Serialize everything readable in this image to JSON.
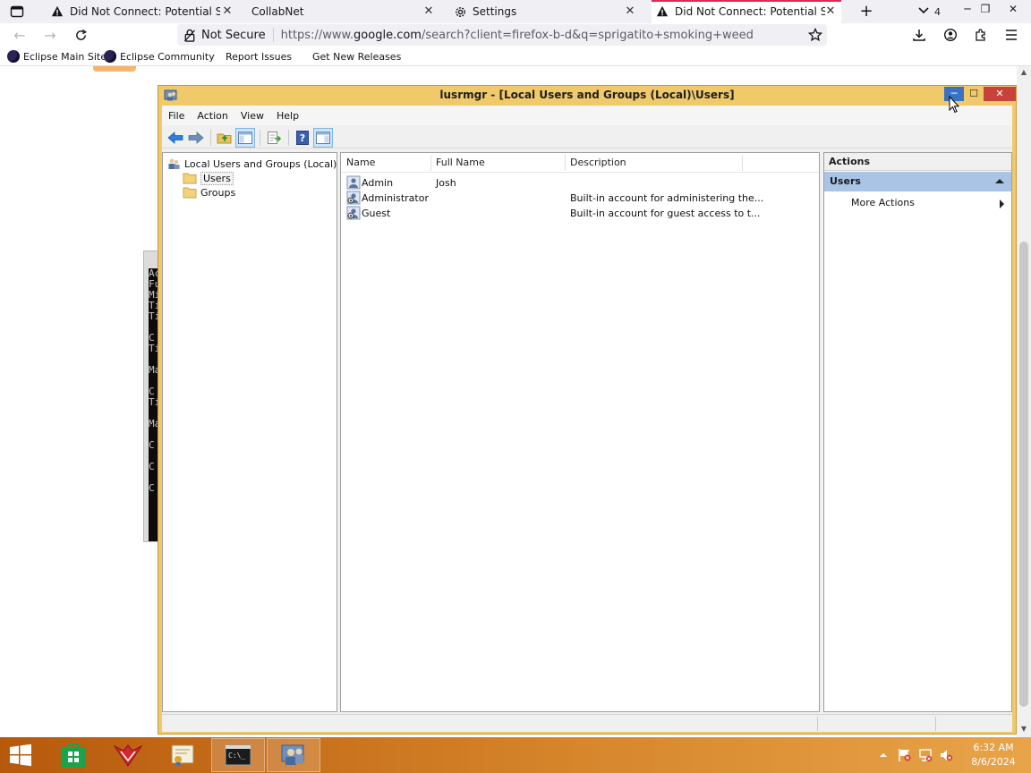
{
  "browser": {
    "tabs": [
      {
        "label": "Did Not Connect: Potential Security Issue",
        "icon": "warning-icon"
      },
      {
        "label": "CollabNet",
        "icon": ""
      },
      {
        "label": "Settings",
        "icon": "gear-icon"
      },
      {
        "label": "Did Not Connect: Potential Security Issue",
        "icon": "warning-icon"
      }
    ],
    "tab_count": "4",
    "security_label": "Not Secure",
    "url_prefix": "https://www.",
    "url_domain": "google.com",
    "url_rest": "/search?client=firefox-b-d&q=sprigatito+smoking+weed",
    "bookmarks": [
      {
        "label": "Eclipse Main Site"
      },
      {
        "label": "Eclipse Community"
      },
      {
        "label": "Report Issues"
      },
      {
        "label": "Get New Releases"
      }
    ]
  },
  "console_fragment": [
    "Ac",
    "Fu",
    "Mi",
    "Ti",
    "Ti",
    "",
    "C",
    "Ti",
    "",
    "Ma",
    "",
    "C",
    "Ti",
    "",
    "Ma",
    "",
    "C",
    "",
    "C",
    "",
    "C"
  ],
  "mmc": {
    "title": "lusrmgr - [Local Users and Groups (Local)\\Users]",
    "menu": [
      "File",
      "Action",
      "View",
      "Help"
    ],
    "tree": {
      "root": "Local Users and Groups (Local)",
      "children": [
        "Users",
        "Groups"
      ]
    },
    "columns": {
      "name": "Name",
      "full_name": "Full Name",
      "description": "Description"
    },
    "users": [
      {
        "name": "Admin",
        "full_name": "Josh",
        "description": ""
      },
      {
        "name": "Administrator",
        "full_name": "",
        "description": "Built-in account for administering the..."
      },
      {
        "name": "Guest",
        "full_name": "",
        "description": "Built-in account for guest access to t..."
      }
    ],
    "actions": {
      "header": "Actions",
      "section": "Users",
      "items": [
        "More Actions"
      ]
    }
  },
  "taskbar": {
    "time": "6:32 AM",
    "date": "8/6/2024"
  },
  "colors": {
    "window_frame": "#f0c96a",
    "taskbar_start": "#b7590c",
    "actions_section": "#a9c4e5",
    "close_button": "#c7423a",
    "minimize_button": "#3a71c1"
  }
}
